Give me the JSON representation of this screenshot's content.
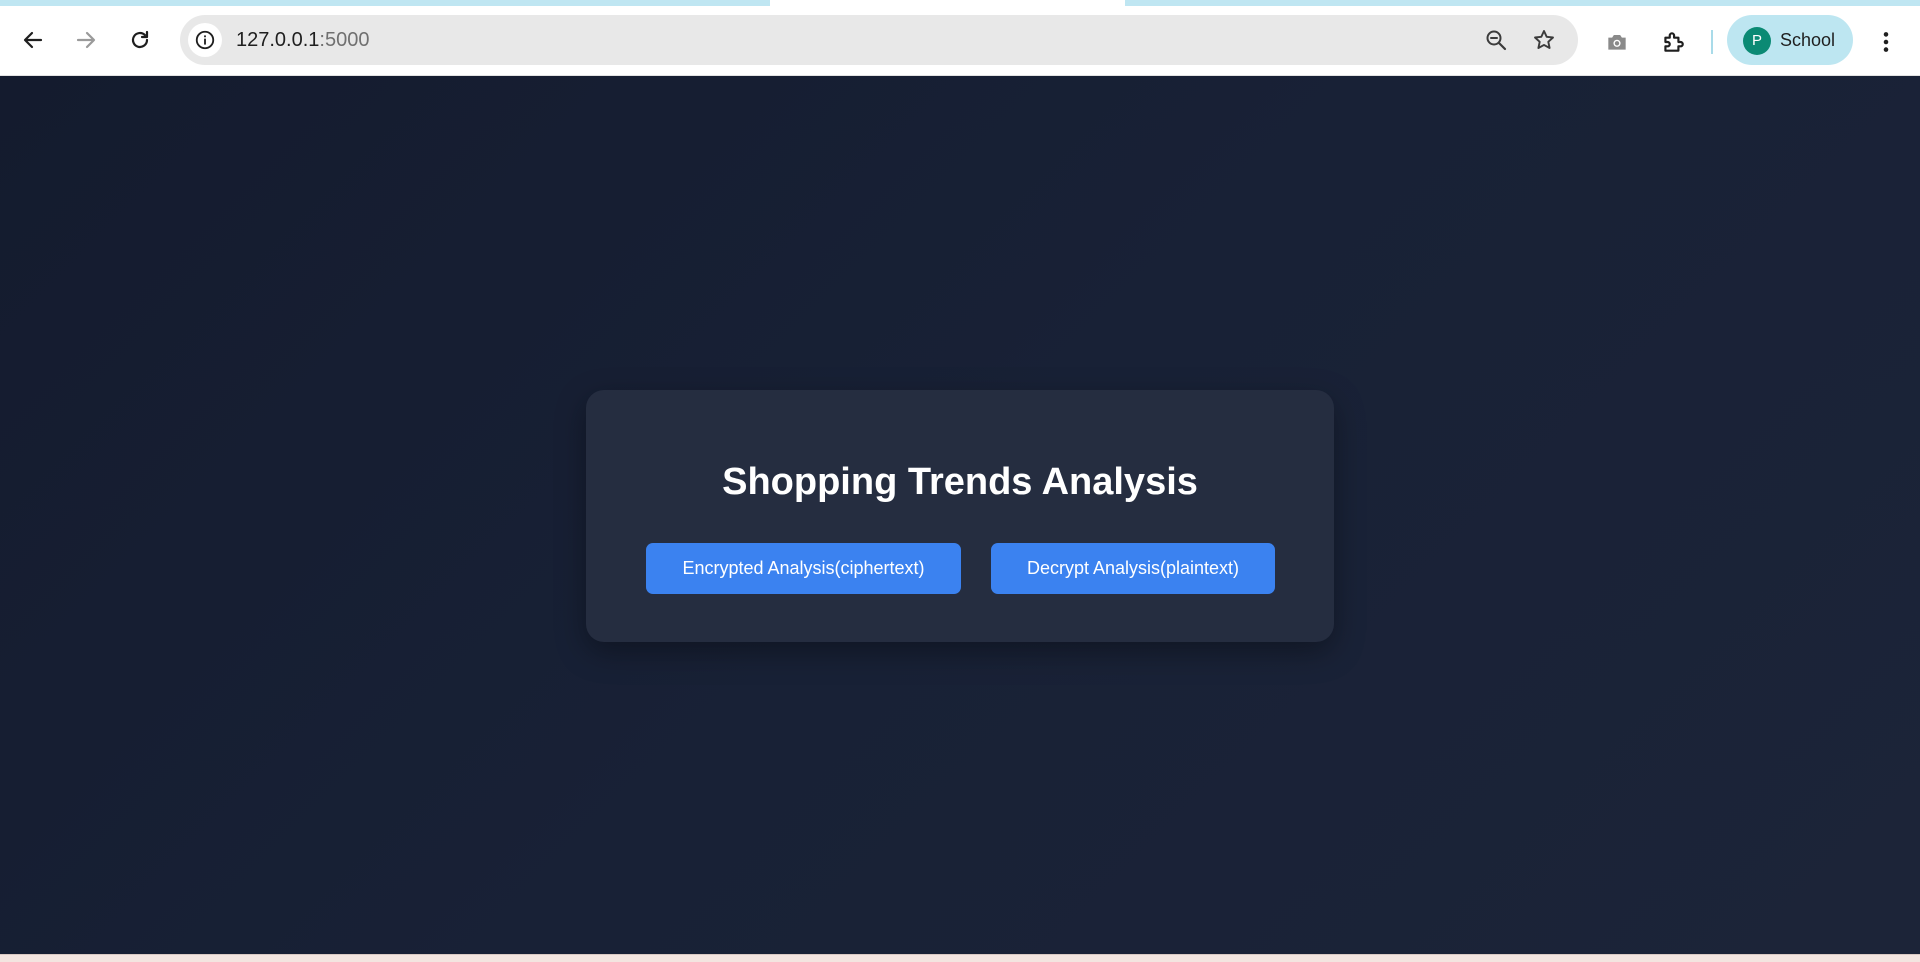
{
  "browser": {
    "url_host": "127.0.0.1",
    "url_port": ":5000",
    "profile_initial": "P",
    "profile_name": "School"
  },
  "page": {
    "title": "Shopping Trends Analysis",
    "buttons": {
      "encrypted_label": "Encrypted Analysis(ciphertext)",
      "decrypt_label": "Decrypt Analysis(plaintext)"
    }
  },
  "colors": {
    "page_background": "#182136",
    "card_background": "#252d40",
    "button_blue": "#3b82f0",
    "profile_chip": "#bde6f1",
    "avatar": "#0b8a74"
  },
  "icons": {
    "back": "arrow-left-icon",
    "forward": "arrow-right-icon",
    "reload": "reload-icon",
    "site_info": "info-icon",
    "zoom": "zoom-out-icon",
    "bookmark": "star-icon",
    "screenshot": "camera-icon",
    "extensions": "puzzle-icon",
    "menu": "kebab-menu-icon"
  }
}
